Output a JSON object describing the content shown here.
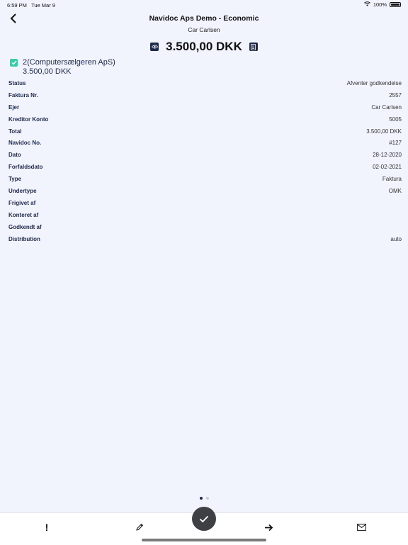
{
  "status_bar": {
    "time": "6:59 PM",
    "date": "Tue Mar 9",
    "battery": "100%"
  },
  "header": {
    "title": "Navidoc Aps Demo - Economic",
    "subtitle": "Car Carlsen",
    "amount": "3.500,00 DKK"
  },
  "company": {
    "name": "2(Computersælgeren ApS)",
    "amount": "3.500,00 DKK",
    "checked": true,
    "check_color": "#3cc9a6"
  },
  "details": [
    {
      "label": "Status",
      "value": "Afventer godkendelse"
    },
    {
      "label": "Faktura Nr.",
      "value": "2557"
    },
    {
      "label": "Ejer",
      "value": "Car Carlsen"
    },
    {
      "label": "Kreditor Konto",
      "value": "5005"
    },
    {
      "label": "Total",
      "value": "3.500,00 DKK"
    },
    {
      "label": "Navidoc No.",
      "value": "#127"
    },
    {
      "label": "Dato",
      "value": "28-12-2020"
    },
    {
      "label": "Forfaldsdato",
      "value": "02-02-2021"
    },
    {
      "label": "Type",
      "value": "Faktura"
    },
    {
      "label": "Undertype",
      "value": "OMK"
    },
    {
      "label": "Frigivet af",
      "value": ""
    },
    {
      "label": "Konteret af",
      "value": ""
    },
    {
      "label": "Godkendt af",
      "value": ""
    },
    {
      "label": "Distribution",
      "value": "auto"
    }
  ],
  "pager": {
    "pages": 2,
    "current": 1
  },
  "toolbar": {
    "flag_label": "!",
    "icons": [
      "exclamation-icon",
      "pencil-icon",
      "check-icon",
      "arrow-right-icon",
      "envelope-icon"
    ]
  },
  "colors": {
    "background": "#f1f3fd",
    "navy": "#1e2a4a",
    "accent": "#3cc9a6",
    "fab": "#3f4044"
  }
}
